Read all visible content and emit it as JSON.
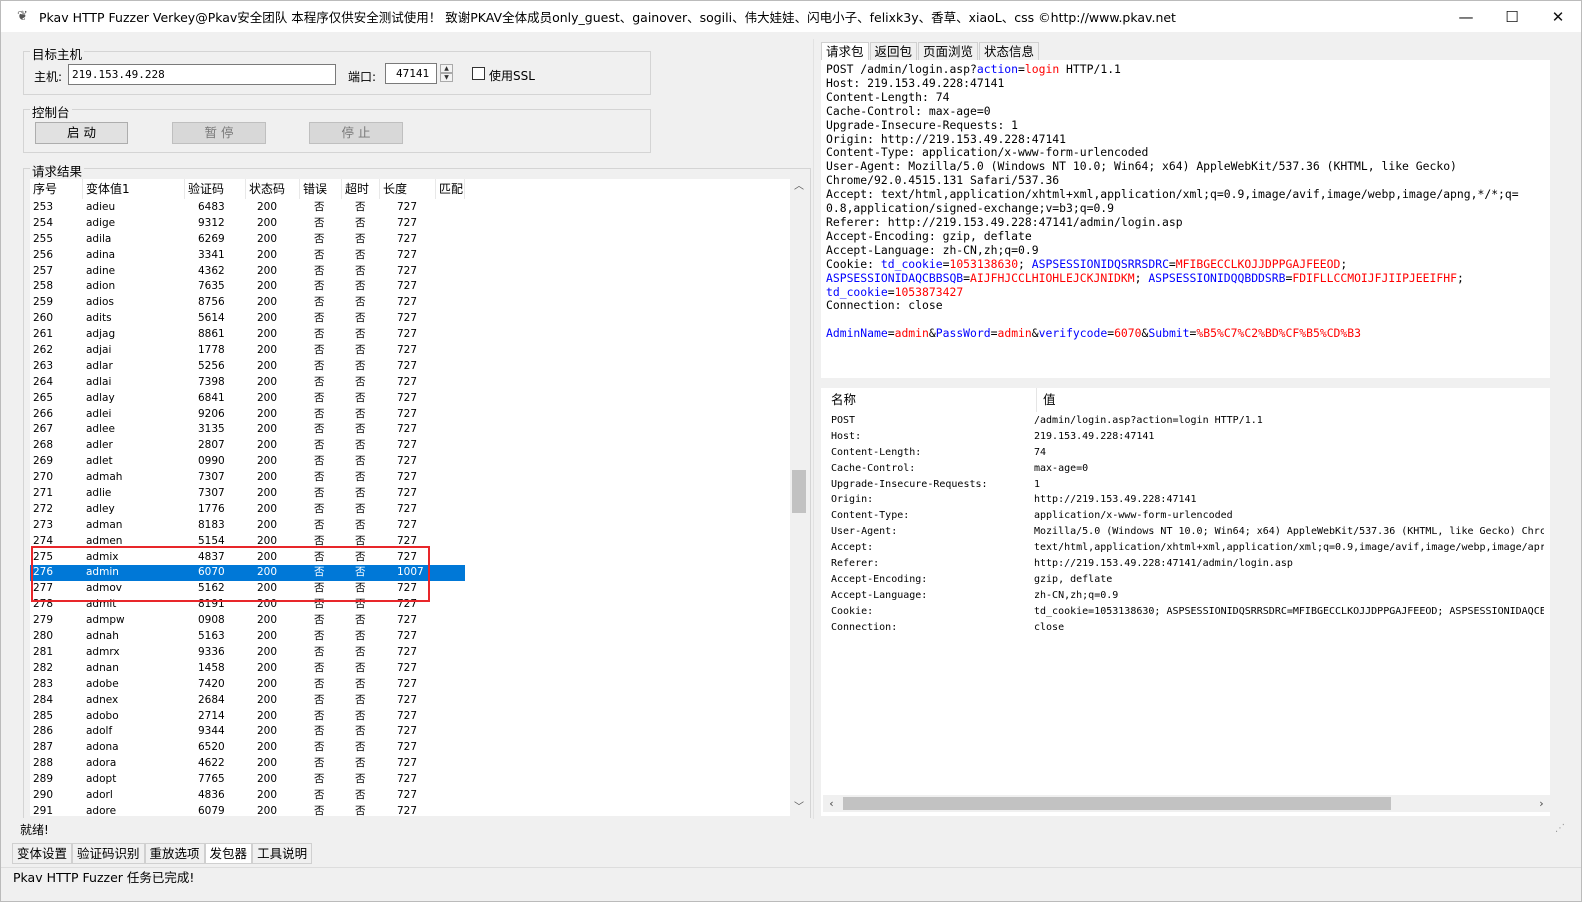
{
  "window": {
    "title": "Pkav HTTP Fuzzer   Verkey@Pkav安全团队  本程序仅供安全测试使用！ 致谢PKAV全体成员only_guest、gainover、sogili、伟大娃娃、闪电小子、felixk3y、香草、xiaoL、css  ©http://www.pkav.net"
  },
  "target": {
    "group_label": "目标主机",
    "host_label": "主机:",
    "host_value": "219.153.49.228",
    "port_label": "端口:",
    "port_value": "47141",
    "ssl_label": "使用SSL"
  },
  "console": {
    "group_label": "控制台",
    "start": "启  动",
    "pause": "暂  停",
    "stop": "停  止"
  },
  "results": {
    "group_label": "请求结果",
    "columns": [
      "序号",
      "变体值1",
      "验证码",
      "状态码",
      "错误",
      "超时",
      "长度",
      "匹配"
    ],
    "rows": [
      [
        "253",
        "adieu",
        "6483",
        "200",
        "否",
        "否",
        "727"
      ],
      [
        "254",
        "adige",
        "9312",
        "200",
        "否",
        "否",
        "727"
      ],
      [
        "255",
        "adila",
        "6269",
        "200",
        "否",
        "否",
        "727"
      ],
      [
        "256",
        "adina",
        "3341",
        "200",
        "否",
        "否",
        "727"
      ],
      [
        "257",
        "adine",
        "4362",
        "200",
        "否",
        "否",
        "727"
      ],
      [
        "258",
        "adion",
        "7635",
        "200",
        "否",
        "否",
        "727"
      ],
      [
        "259",
        "adios",
        "8756",
        "200",
        "否",
        "否",
        "727"
      ],
      [
        "260",
        "adits",
        "5614",
        "200",
        "否",
        "否",
        "727"
      ],
      [
        "261",
        "adjag",
        "8861",
        "200",
        "否",
        "否",
        "727"
      ],
      [
        "262",
        "adjai",
        "1778",
        "200",
        "否",
        "否",
        "727"
      ],
      [
        "263",
        "adlar",
        "5256",
        "200",
        "否",
        "否",
        "727"
      ],
      [
        "264",
        "adlai",
        "7398",
        "200",
        "否",
        "否",
        "727"
      ],
      [
        "265",
        "adlay",
        "6841",
        "200",
        "否",
        "否",
        "727"
      ],
      [
        "266",
        "adlei",
        "9206",
        "200",
        "否",
        "否",
        "727"
      ],
      [
        "267",
        "adlee",
        "3135",
        "200",
        "否",
        "否",
        "727"
      ],
      [
        "268",
        "adler",
        "2807",
        "200",
        "否",
        "否",
        "727"
      ],
      [
        "269",
        "adlet",
        "0990",
        "200",
        "否",
        "否",
        "727"
      ],
      [
        "270",
        "admah",
        "7307",
        "200",
        "否",
        "否",
        "727"
      ],
      [
        "271",
        "adlie",
        "7307",
        "200",
        "否",
        "否",
        "727"
      ],
      [
        "272",
        "adley",
        "1776",
        "200",
        "否",
        "否",
        "727"
      ],
      [
        "273",
        "adman",
        "8183",
        "200",
        "否",
        "否",
        "727"
      ],
      [
        "274",
        "admen",
        "5154",
        "200",
        "否",
        "否",
        "727"
      ],
      [
        "275",
        "admix",
        "4837",
        "200",
        "否",
        "否",
        "727"
      ],
      [
        "276",
        "admin",
        "6070",
        "200",
        "否",
        "否",
        "1007"
      ],
      [
        "277",
        "admov",
        "5162",
        "200",
        "否",
        "否",
        "727"
      ],
      [
        "278",
        "admit",
        "8191",
        "200",
        "否",
        "否",
        "727"
      ],
      [
        "279",
        "admpw",
        "0908",
        "200",
        "否",
        "否",
        "727"
      ],
      [
        "280",
        "adnah",
        "5163",
        "200",
        "否",
        "否",
        "727"
      ],
      [
        "281",
        "admrx",
        "9336",
        "200",
        "否",
        "否",
        "727"
      ],
      [
        "282",
        "adnan",
        "1458",
        "200",
        "否",
        "否",
        "727"
      ],
      [
        "283",
        "adobe",
        "7420",
        "200",
        "否",
        "否",
        "727"
      ],
      [
        "284",
        "adnex",
        "2684",
        "200",
        "否",
        "否",
        "727"
      ],
      [
        "285",
        "adobo",
        "2714",
        "200",
        "否",
        "否",
        "727"
      ],
      [
        "286",
        "adolf",
        "9344",
        "200",
        "否",
        "否",
        "727"
      ],
      [
        "287",
        "adona",
        "6520",
        "200",
        "否",
        "否",
        "727"
      ],
      [
        "288",
        "adora",
        "4622",
        "200",
        "否",
        "否",
        "727"
      ],
      [
        "289",
        "adopt",
        "7765",
        "200",
        "否",
        "否",
        "727"
      ],
      [
        "290",
        "adorl",
        "4836",
        "200",
        "否",
        "否",
        "727"
      ],
      [
        "291",
        "adore",
        "6079",
        "200",
        "否",
        "否",
        "727"
      ]
    ],
    "selected_row": "276"
  },
  "right_tabs": [
    "请求包",
    "返回包",
    "页面浏览",
    "状态信息"
  ],
  "request": {
    "line1_a": "POST /admin/login.asp?",
    "line1_k": "action",
    "line1_eq": "=",
    "line1_v": "login",
    "line1_b": " HTTP/1.1",
    "headers": [
      "Host: 219.153.49.228:47141",
      "Content-Length: 74",
      "Cache-Control: max-age=0",
      "Upgrade-Insecure-Requests: 1",
      "Origin: http://219.153.49.228:47141",
      "Content-Type: application/x-www-form-urlencoded",
      "User-Agent: Mozilla/5.0 (Windows NT 10.0; Win64; x64) AppleWebKit/537.36 (KHTML, like Gecko)",
      "Chrome/92.0.4515.131 Safari/537.36",
      "Accept: text/html,application/xhtml+xml,application/xml;q=0.9,image/avif,image/webp,image/apng,*/*;q=",
      "0.8,application/signed-exchange;v=b3;q=0.9",
      "Referer: http://219.153.49.228:47141/admin/login.asp",
      "Accept-Encoding: gzip, deflate",
      "Accept-Language: zh-CN,zh;q=0.9"
    ],
    "cookie_label": "Cookie: ",
    "cookie_k1": "td_cookie",
    "cookie_v1": "1053138630",
    "cookie_k2": "ASPSESSIONIDQSRRSDRC",
    "cookie_v2": "MFIBGECCLKOJJDPPGAJFEEOD",
    "cookie_k3": "ASPSESSIONIDAQCBBSQB",
    "cookie_v3": "AIJFHJCCLHIOHLEJCKJNIDKM",
    "cookie_k4": "ASPSESSIONIDQQBDDSRB",
    "cookie_v4": "FDIFLLCCMOIJFJIIPJEEIFHF",
    "cookie_k5": "td_cookie",
    "cookie_v5": "1053873427",
    "connection": "Connection: close",
    "body_k1": "AdminName",
    "body_v1": "admin",
    "body_k2": "PassWord",
    "body_v2": "admin",
    "body_k3": "verifycode",
    "body_v3": "6070",
    "body_k4": "Submit",
    "body_v4": "%B5%C7%C2%BD%CF%B5%CD%B3"
  },
  "kv": {
    "col_name": "名称",
    "col_value": "值",
    "rows": [
      [
        "POST",
        "/admin/login.asp?action=login HTTP/1.1"
      ],
      [
        "Host:",
        "219.153.49.228:47141"
      ],
      [
        "Content-Length:",
        "74"
      ],
      [
        "Cache-Control:",
        "max-age=0"
      ],
      [
        "Upgrade-Insecure-Requests:",
        "1"
      ],
      [
        "Origin:",
        "http://219.153.49.228:47141"
      ],
      [
        "Content-Type:",
        "application/x-www-form-urlencoded"
      ],
      [
        "User-Agent:",
        "Mozilla/5.0 (Windows NT 10.0; Win64; x64) AppleWebKit/537.36 (KHTML, like Gecko) Chrc"
      ],
      [
        "Accept:",
        "text/html,application/xhtml+xml,application/xml;q=0.9,image/avif,image/webp,image/apr"
      ],
      [
        "Referer:",
        "http://219.153.49.228:47141/admin/login.asp"
      ],
      [
        "Accept-Encoding:",
        "gzip, deflate"
      ],
      [
        "Accept-Language:",
        "zh-CN,zh;q=0.9"
      ],
      [
        "Cookie:",
        "td_cookie=1053138630; ASPSESSIONIDQSRRSDRC=MFIBGECCLKOJJDPPGAJFEEOD; ASPSESSIONIDAQCE"
      ],
      [
        "Connection:",
        "close"
      ]
    ]
  },
  "status": {
    "ready": "就绪!",
    "bottom": "Pkav HTTP Fuzzer 任务已完成!"
  },
  "bottom_tabs": [
    "变体设置",
    "验证码识别",
    "重放选项",
    "发包器",
    "工具说明"
  ],
  "colors": {
    "selection": "#0078d7",
    "highlight_box": "#e8262a",
    "key_blue": "#0000ff",
    "value_red": "#ff0000"
  }
}
